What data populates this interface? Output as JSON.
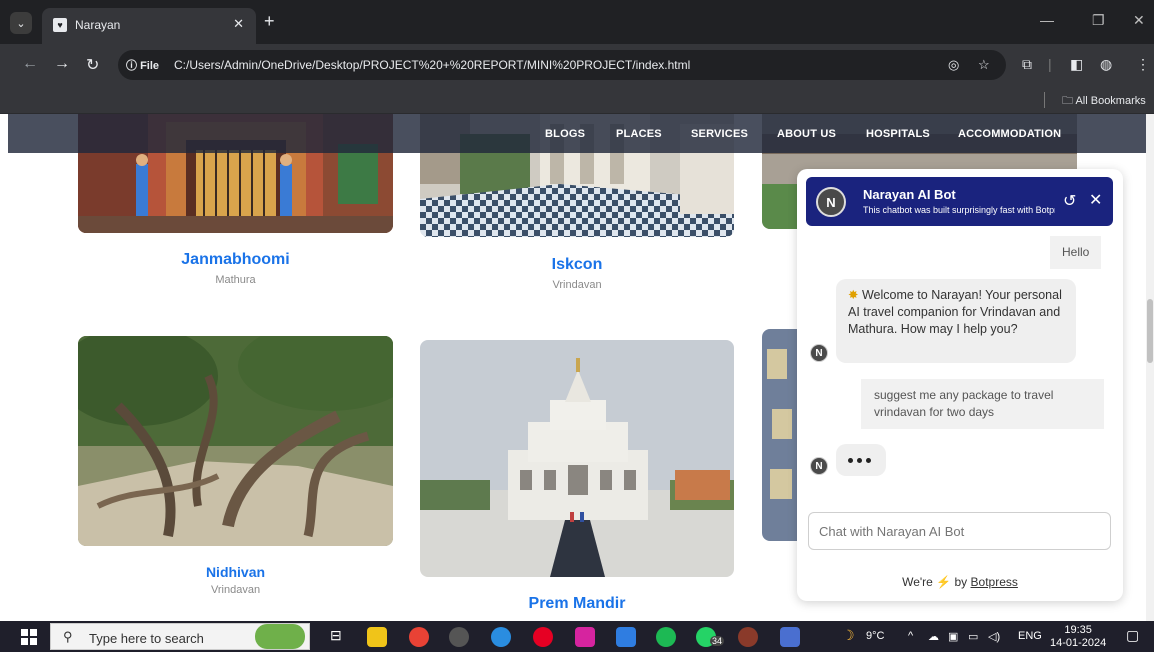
{
  "browser": {
    "tab_title": "Narayan",
    "site_info": "File",
    "url": "C:/Users/Admin/OneDrive/Desktop/PROJECT%20+%20REPORT/MINI%20PROJECT/index.html",
    "all_bookmarks": "All Bookmarks"
  },
  "nav": {
    "items": [
      "BLOGS",
      "PLACES",
      "SERVICES",
      "ABOUT US",
      "HOSPITALS",
      "ACCOMMODATION"
    ]
  },
  "places": [
    {
      "title": "Janmabhoomi",
      "subtitle": "Mathura"
    },
    {
      "title": "Iskcon",
      "subtitle": "Vrindavan"
    },
    {
      "title": "Nidhivan",
      "subtitle": "Vrindavan"
    },
    {
      "title": "Prem Mandir",
      "subtitle": ""
    }
  ],
  "chat": {
    "bot_name": "Narayan AI Bot",
    "bot_description": "This chatbot was built surprisingly fast with Botpress",
    "avatar_letter": "N",
    "messages": {
      "user_hello": "Hello",
      "bot_welcome": "Welcome to Narayan! Your personal AI travel companion for Vrindavan and Mathura. How may I help you?",
      "user_query": "suggest me any package to travel vrindavan for two days"
    },
    "input_placeholder": "Chat with Narayan AI Bot",
    "footer_prefix": "We're",
    "footer_by": "by",
    "footer_brand": "Botpress"
  },
  "taskbar": {
    "search_placeholder": "Type here to search",
    "weather": "9°C",
    "language": "ENG",
    "time": "19:35",
    "date": "14-01-2024",
    "whatsapp_badge": "34"
  },
  "colors": {
    "nav_bg": "#21283a",
    "link_blue": "#1a73e8",
    "chat_header": "#1a237e",
    "botpress_bolt": "#f5a623"
  }
}
